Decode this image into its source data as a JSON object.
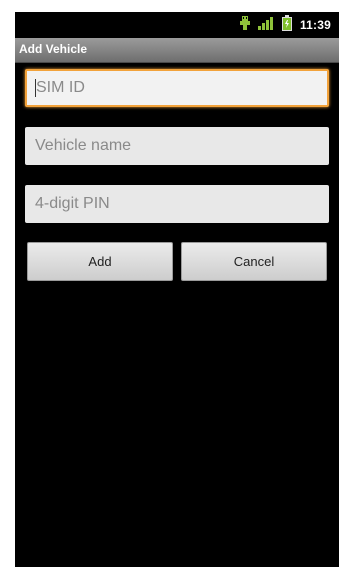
{
  "status_bar": {
    "time": "11:39",
    "icons": [
      "usb-debug-icon",
      "signal-icon",
      "battery-icon"
    ]
  },
  "screen": {
    "title": "Add Vehicle"
  },
  "form": {
    "sim_id": {
      "value": "",
      "placeholder": "SIM ID"
    },
    "vehicle_name": {
      "value": "",
      "placeholder": "Vehicle name"
    },
    "pin": {
      "value": "",
      "placeholder": "4-digit PIN"
    }
  },
  "buttons": {
    "add_label": "Add",
    "cancel_label": "Cancel"
  },
  "colors": {
    "focus_accent": "#f2a23a",
    "background": "#000000",
    "title_bar": "#8a8a8a"
  }
}
